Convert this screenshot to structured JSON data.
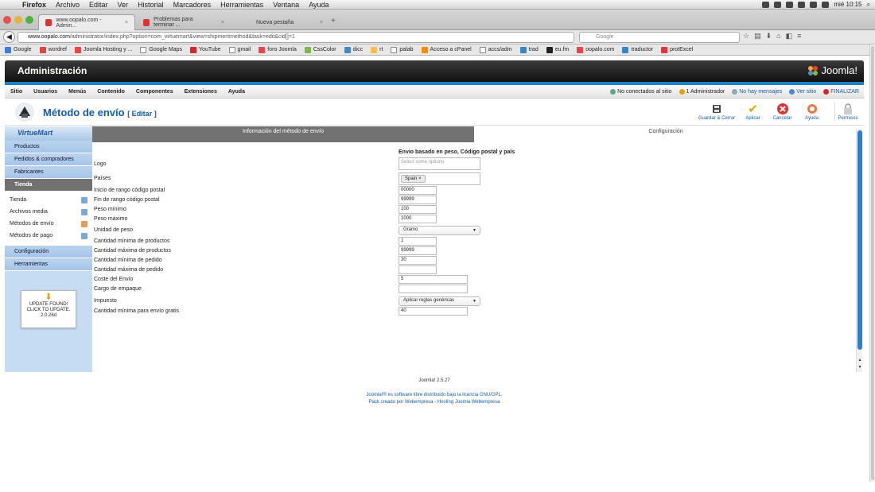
{
  "os_menubar": {
    "app": "Firefox",
    "items": [
      "Archivo",
      "Editar",
      "Ver",
      "Historial",
      "Marcadores",
      "Herramientas",
      "Ventana",
      "Ayuda"
    ],
    "clock": "mié 10:15"
  },
  "browser": {
    "tabs": [
      {
        "label": "www.oopalo.com - Admin..."
      },
      {
        "label": "Problemas para terminar ..."
      },
      {
        "label": "Nueva pestaña"
      }
    ],
    "url_host": "www.oopalo.com",
    "url_path": "/administrator/index.php?option=com_virtuemart&view=shipmentmethod&task=edit&cid[]=1",
    "search_placeholder": "Google",
    "bookmarks": [
      "Google",
      "wordref",
      "Joomla Hosting y ...",
      "Google Maps",
      "YouTube",
      "gmail",
      "foro Joomla",
      "CssColor",
      "dicc",
      "rt",
      "palab",
      "Acceso a cPanel",
      "accs/adm",
      "trad",
      "eu.fm",
      "oopalo.com",
      "traductor",
      "protExcel"
    ]
  },
  "admin": {
    "header_title": "Administración",
    "logo_text": "Joomla!",
    "menu": [
      "Sitio",
      "Usuarios",
      "Menús",
      "Contenido",
      "Componentes",
      "Extensiones",
      "Ayuda"
    ],
    "status": {
      "visitors": "No conectados al sitio",
      "admins": "1 Administrador",
      "messages": "No hay mensajes",
      "view_site": "Ver sitio",
      "logout": "FINALIZAR"
    },
    "page_title": "Método de envío",
    "page_subtitle": "[ Editar ]",
    "toolbar_buttons": [
      "Guardar & Cerrar",
      "Aplicar",
      "Cancelar",
      "Ayuda",
      "Permisos"
    ]
  },
  "sidebar": {
    "brand": "VirtueMart",
    "top_items": [
      "Productos",
      "Pedidos & compradores",
      "Fabricantes",
      "Tienda"
    ],
    "sub_items": [
      "Tienda",
      "Archivos media",
      "Métodos de envío",
      "Métodos de pago"
    ],
    "bottom_items": [
      "Configuración",
      "Herramientas"
    ],
    "update_box": {
      "line1": "UPDATE FOUND!",
      "line2": "CLICK TO UPDATE.",
      "version": "2.0.26d"
    }
  },
  "form": {
    "tab_info": "Información del método de envío",
    "tab_config": "Configuración",
    "plugin_title": "Envio basado en peso, Código postal y país",
    "fields": {
      "logo": {
        "label": "Logo",
        "placeholder": "Select some options"
      },
      "paises": {
        "label": "Países",
        "chip": "Spain"
      },
      "zip_start": {
        "label": "Inicio de rango código postal",
        "value": "00000"
      },
      "zip_end": {
        "label": "Fin de rango código postal",
        "value": "99999"
      },
      "weight_min": {
        "label": "Peso mínimo",
        "value": "100"
      },
      "weight_max": {
        "label": "Peso máximo",
        "value": "1000"
      },
      "weight_unit": {
        "label": "Unidad de peso",
        "value": "Gramo"
      },
      "nbproducts_min": {
        "label": "Cantidad mínima de productos",
        "value": "1"
      },
      "nbproducts_max": {
        "label": "Cantidad máxima de productos",
        "value": "99999"
      },
      "orderamount_min": {
        "label": "Cantidad mínima de pedido",
        "value": "30"
      },
      "orderamount_max": {
        "label": "Cantidad máxima de pedido",
        "value": ""
      },
      "shipment_cost": {
        "label": "Coste del Envío",
        "value": "5"
      },
      "package_fee": {
        "label": "Cargo de empaque",
        "value": ""
      },
      "tax": {
        "label": "Impuesto",
        "value": "Aplicar reglas genéricas"
      },
      "free_shipment": {
        "label": "Cantidad mínima para envío gratis",
        "value": "40"
      }
    }
  },
  "footer": {
    "version": "Joomla! 2.5.27",
    "license": "Joomla!® es software libre distribuido bajo la licencia GNU/GPL.",
    "credits": "Pack creado por Webempresa - Hosting Joomla Webempresa"
  }
}
